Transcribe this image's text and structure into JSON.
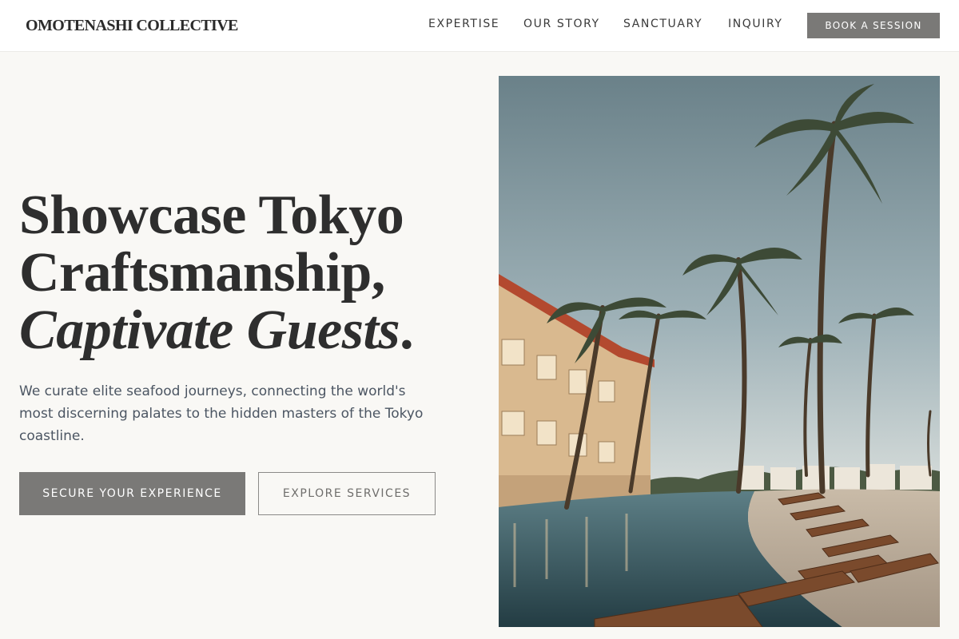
{
  "header": {
    "logo": "OMOTENASHI COLLECTIVE",
    "nav": [
      "EXPERTISE",
      "OUR STORY",
      "SANCTUARY",
      "INQUIRY"
    ],
    "cta": "BOOK A SESSION"
  },
  "hero": {
    "title_line1": "Showcase Tokyo",
    "title_line2": "Craftsmanship,",
    "title_line3": "Captivate Guests",
    "title_period": ".",
    "subtitle": "We curate elite seafood journeys, connecting the world's most discerning palates to the hidden masters of the Tokyo coastline.",
    "primary_button": "SECURE YOUR EXPERIENCE",
    "secondary_button": "EXPLORE SERVICES"
  },
  "image": {
    "subject": "resort-pool-palms-photo"
  },
  "colors": {
    "background": "#f9f8f5",
    "header_bg": "#ffffff",
    "button_fill": "#7a7977",
    "text_dark": "#2e2e2e",
    "text_body": "#4c5663"
  }
}
